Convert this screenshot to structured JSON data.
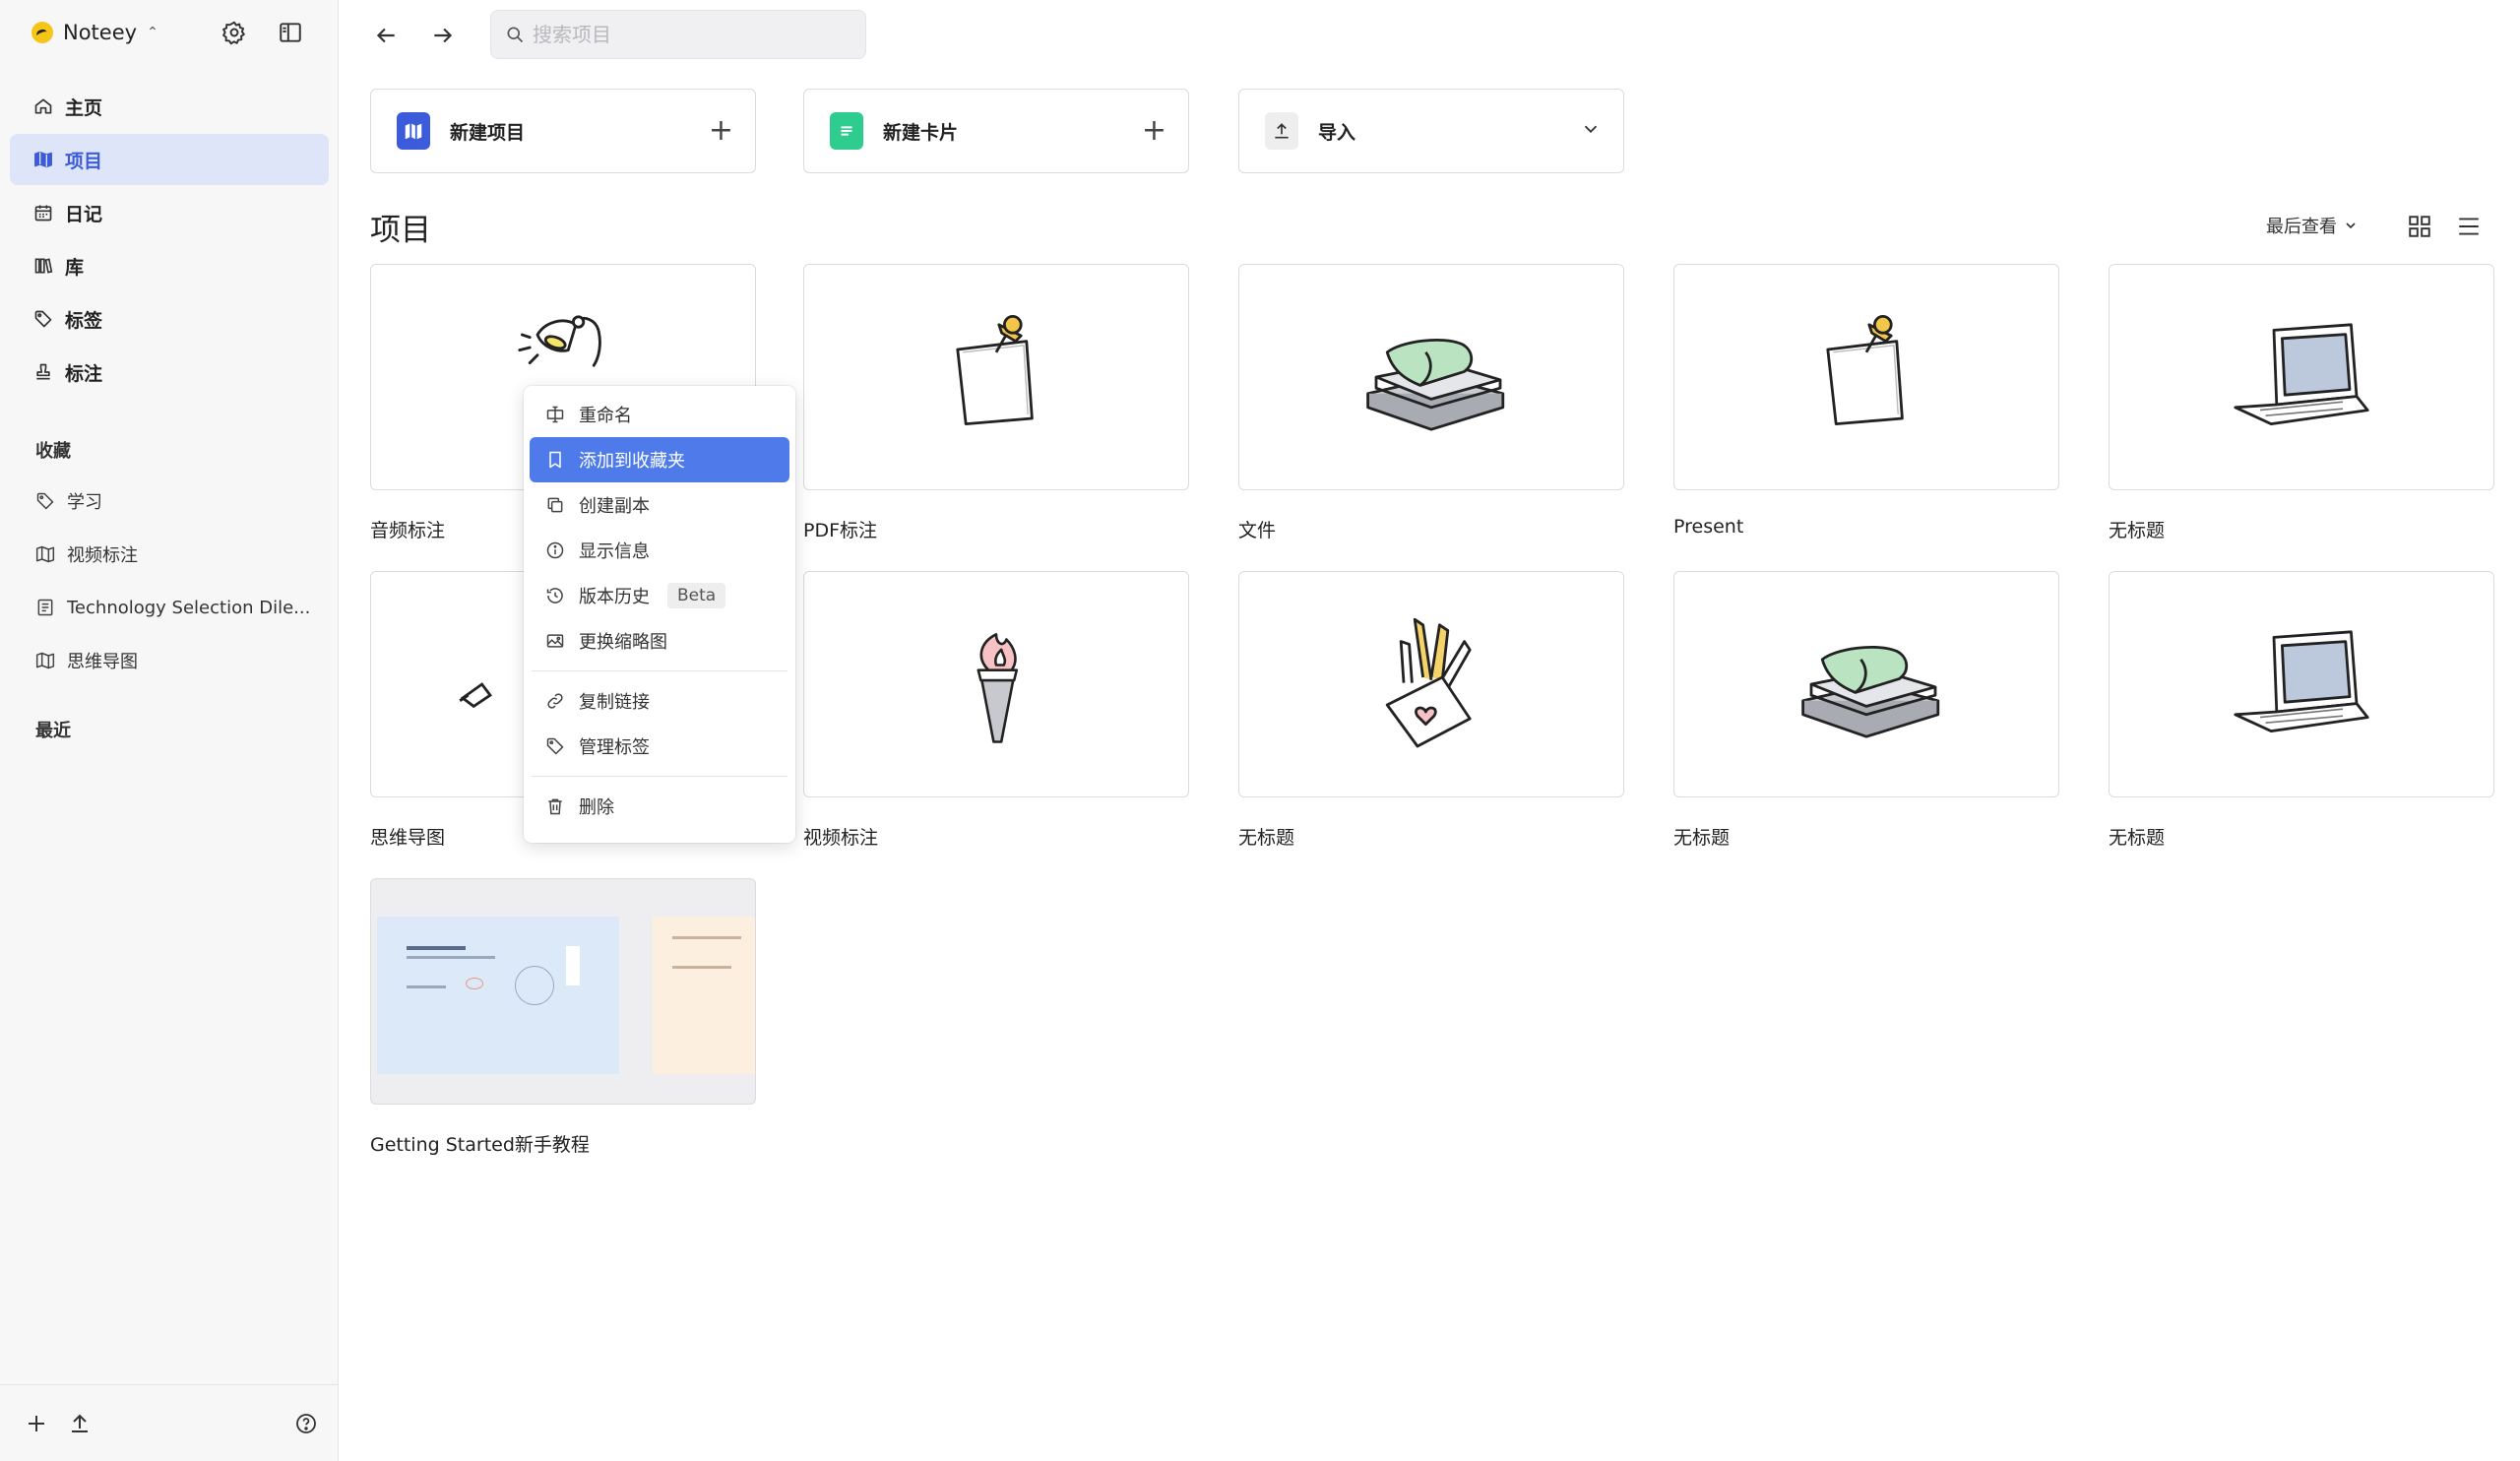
{
  "app": {
    "name": "Noteey"
  },
  "nav": [
    {
      "label": "主页",
      "icon": "home-icon"
    },
    {
      "label": "项目",
      "icon": "map-icon"
    },
    {
      "label": "日记",
      "icon": "calendar-icon"
    },
    {
      "label": "库",
      "icon": "library-icon"
    },
    {
      "label": "标签",
      "icon": "tag-icon"
    },
    {
      "label": "标注",
      "icon": "stamp-icon"
    }
  ],
  "favorites": {
    "title": "收藏",
    "items": [
      {
        "label": "学习",
        "icon": "tag-icon"
      },
      {
        "label": "视频标注",
        "icon": "map-icon"
      },
      {
        "label": "Technology Selection Dile...",
        "icon": "document-icon"
      },
      {
        "label": "思维导图",
        "icon": "map-icon"
      }
    ]
  },
  "recent": {
    "title": "最近"
  },
  "search": {
    "placeholder": "搜索项目"
  },
  "actions": {
    "new_project": "新建项目",
    "new_card": "新建卡片",
    "import": "导入"
  },
  "projects": {
    "heading": "项目",
    "sort_label": "最后查看",
    "items": [
      {
        "label": "音频标注",
        "art": "lamp"
      },
      {
        "label": "PDF标注",
        "art": "note"
      },
      {
        "label": "文件",
        "art": "books"
      },
      {
        "label": "Present",
        "art": "note"
      },
      {
        "label": "无标题",
        "art": "laptop"
      },
      {
        "label": "思维导图",
        "art": "pen"
      },
      {
        "label": "视频标注",
        "art": "torch"
      },
      {
        "label": "无标题",
        "art": "pencils"
      },
      {
        "label": "无标题",
        "art": "books"
      },
      {
        "label": "无标题",
        "art": "laptop"
      },
      {
        "label": "Getting Started新手教程",
        "art": "preview"
      }
    ]
  },
  "context_menu": {
    "items": [
      {
        "label": "重命名",
        "icon": "rename-icon"
      },
      {
        "label": "添加到收藏夹",
        "icon": "bookmark-icon",
        "active": true
      },
      {
        "label": "创建副本",
        "icon": "duplicate-icon"
      },
      {
        "label": "显示信息",
        "icon": "info-icon"
      },
      {
        "label": "版本历史",
        "icon": "history-icon",
        "badge": "Beta"
      },
      {
        "label": "更换缩略图",
        "icon": "image-icon"
      },
      {
        "label": "复制链接",
        "icon": "link-icon"
      },
      {
        "label": "管理标签",
        "icon": "tag-icon"
      },
      {
        "label": "删除",
        "icon": "trash-icon"
      }
    ]
  },
  "colors": {
    "accent": "#3b5bdb",
    "menu_highlight": "#4f7bea",
    "nav_active_bg": "#dfe5f8",
    "brand_logo": "#f5c518"
  }
}
